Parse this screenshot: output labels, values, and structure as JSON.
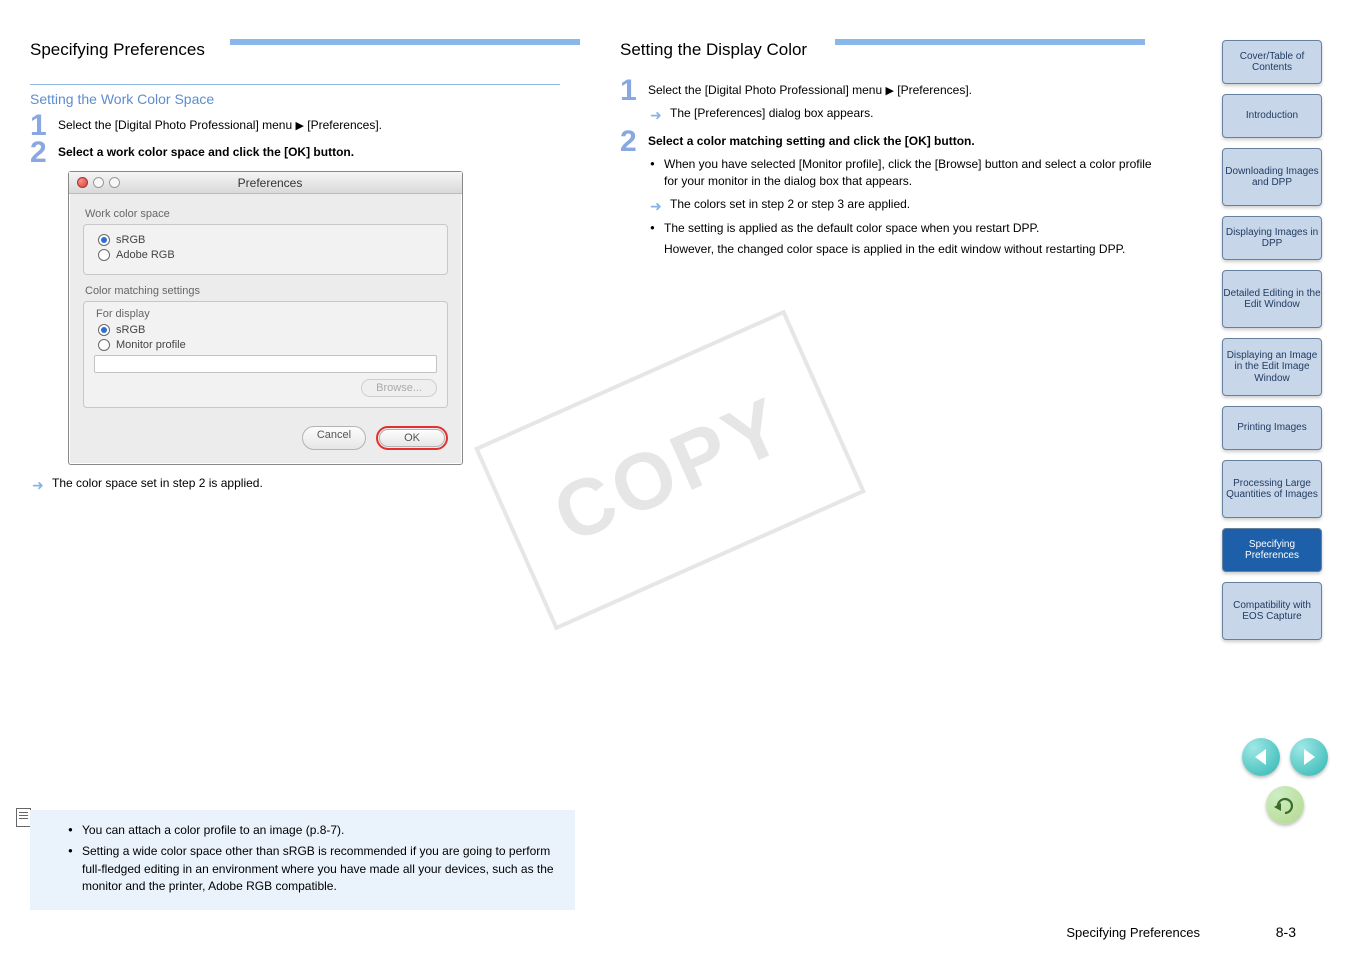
{
  "sections": {
    "left": {
      "heading": "Specifying Preferences",
      "sub": "Setting the Work Color Space",
      "step1_a": "Select the [Digital Photo Professional] menu ",
      "step1_b": " [Preferences].",
      "step2": "Select a work color space and click the [OK] button.",
      "result": "The color space set in step 2 is applied."
    },
    "right": {
      "heading": "Setting the Display Color",
      "step1_a": "Select the [Digital Photo Professional] menu ",
      "step1_b": " [Preferences].",
      "result": "The [Preferences] dialog box appears.",
      "step2": "Select a color matching setting and click the [OK] button.",
      "step3_a": "When you have selected [Monitor profile], click the [Browse] button and select a color profile for your monitor in the dialog box that appears.",
      "result2": "The colors set in step 2 or step 3 are applied.",
      "extra1": "The setting is applied as the default color space when you restart DPP.",
      "extra2": "However, the changed color space is applied in the edit window without restarting DPP."
    },
    "notes": [
      "You can attach a color profile to an image (p.8-7).",
      "Setting a wide color space other than sRGB is recommended if you are going to perform full-fledged editing in an environment where you have made all your devices, such as the monitor and the printer, Adobe RGB compatible."
    ]
  },
  "mac": {
    "title": "Preferences",
    "g1": "Work color space",
    "r1": "sRGB",
    "r2": "Adobe RGB",
    "g2": "Color matching settings",
    "sub": "For display",
    "r3": "sRGB",
    "r4": "Monitor profile",
    "browse": "Browse...",
    "cancel": "Cancel",
    "ok": "OK"
  },
  "sidebar": [
    "Cover/Table of Contents",
    "Introduction",
    "Downloading Images and DPP",
    "Displaying Images in DPP",
    "Detailed Editing in the Edit Window",
    "Displaying an Image in the Edit Image Window",
    "Printing Images",
    "Processing Large Quantities of Images",
    "Specifying Preferences",
    "Compatibility with EOS Capture"
  ],
  "page_label": "Specifying Preferences",
  "page_no": "8-3",
  "watermark": "COPY"
}
